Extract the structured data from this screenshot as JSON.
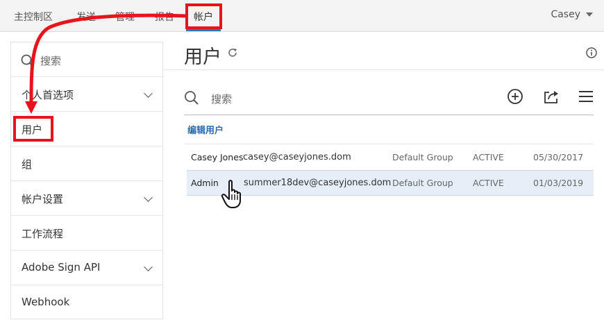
{
  "topnav": {
    "items": [
      {
        "label": "主控制区"
      },
      {
        "label": "发送"
      },
      {
        "label": "管理"
      },
      {
        "label": "报告"
      },
      {
        "label": "帐户"
      }
    ],
    "user": "Casey"
  },
  "sidebar": {
    "search_placeholder": "搜索",
    "items": [
      {
        "label": "个人首选项",
        "has_chevron": true
      },
      {
        "label": "用户",
        "has_chevron": false
      },
      {
        "label": "组",
        "has_chevron": false
      },
      {
        "label": "帐户设置",
        "has_chevron": true
      },
      {
        "label": "工作流程",
        "has_chevron": false
      },
      {
        "label": "Adobe Sign API",
        "has_chevron": true
      },
      {
        "label": "Webhook",
        "has_chevron": false
      }
    ]
  },
  "main": {
    "title": "用户",
    "search_placeholder": "搜索",
    "edit_link": "编辑用户",
    "users": [
      {
        "name": "Casey Jones",
        "email": "casey@caseyjones.dom",
        "group": "Default Group",
        "status": "ACTIVE",
        "date": "05/30/2017"
      },
      {
        "name": "Admin",
        "email": "summer18dev@caseyjones.dom",
        "group": "Default Group",
        "status": "ACTIVE",
        "date": "01/03/2019"
      }
    ]
  },
  "colors": {
    "accent": "#2a7ab9",
    "link": "#2a6ab0",
    "highlight": "#e8131b",
    "selected_row": "#e6eef7"
  },
  "icons": {
    "search": "search-icon",
    "refresh": "refresh-icon",
    "info": "info-icon",
    "add": "add-circle-icon",
    "share": "share-icon",
    "menu": "hamburger-menu-icon",
    "user_caret": "caret-down-icon",
    "chevron": "chevron-down-icon",
    "cursor": "hand-pointer-icon"
  }
}
